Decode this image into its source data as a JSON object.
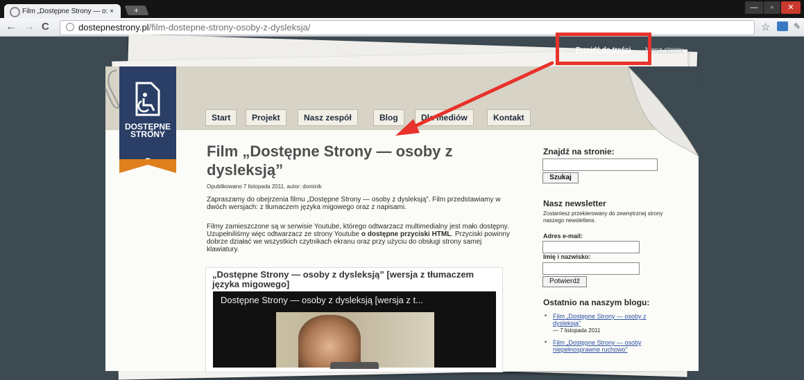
{
  "browser": {
    "tab_title": "Film „Dostępne Strony — o: ×",
    "new_tab": "+",
    "url_host": "dostepnestrony.pl",
    "url_path": "/film-dostepne-strony-osoby-z-dysleksja/",
    "back": "←",
    "forward": "→",
    "reload": "C",
    "star": "☆"
  },
  "page": {
    "skip_link": "Przejdź do treści",
    "sitemap_link": "Mapa strony",
    "logo_line1": "DOSTĘPNE",
    "logo_line2": "STRONY",
    "nav": [
      "Start",
      "Projekt",
      "Nasz zespół",
      "Blog",
      "Dla mediów",
      "Kontakt"
    ],
    "title": "Film „Dostępne Strony — osoby z dysleksją”",
    "meta": "Opublikowano 7 listopada 2011, autor: dominik",
    "para1": "Zapraszamy do obejrzenia filmu „Dostępne Strony — osoby z dysleksją”. Film przedstawiamy w dwóch wersjach: z tłumaczem języka migowego oraz z napisami.",
    "para2_a": "Filmy zamieszczone są w serwisie Youtube, którego odtwarzacz multimedialny jest mało dostępny. Uzupełniliśmy więc odtwarzacz ze strony Youtube ",
    "para2_b": "o dostępne przyciski HTML",
    "para2_c": ". Przyciski powinny dobrze działać we wszystkich czytnikach ekranu oraz przy użyciu do obsługi strony samej klawiatury.",
    "video_heading": "„Dostępne Strony — osoby z dysleksją” [wersja z tłumaczem języka migowego]",
    "player_title": "Dostępne Strony — osoby z dysleksją [wersja z t..."
  },
  "sidebar": {
    "search_heading": "Znajdź na stronie:",
    "search_button": "Szukaj",
    "newsletter_heading": "Nasz newsletter",
    "newsletter_note": "Zostaniesz przekierowany do zewnętrznej strony naszego newslettera.",
    "email_label": "Adres e-mail:",
    "name_label": "Imię i nazwisko:",
    "confirm_button": "Potwierdź",
    "blog_heading": "Ostatnio na naszym blogu:",
    "posts": [
      {
        "title": "Film „Dostępne Strony — osoby z dysleksją”",
        "date": "— 7 listopada 2011"
      },
      {
        "title": "Film „Dostępne Strony — osoby niepełnosprawne ruchowo”",
        "date": ""
      }
    ]
  },
  "colors": {
    "annotation": "#e8322b",
    "logo_blue": "#2a3e66",
    "logo_orange": "#e07f1e"
  }
}
